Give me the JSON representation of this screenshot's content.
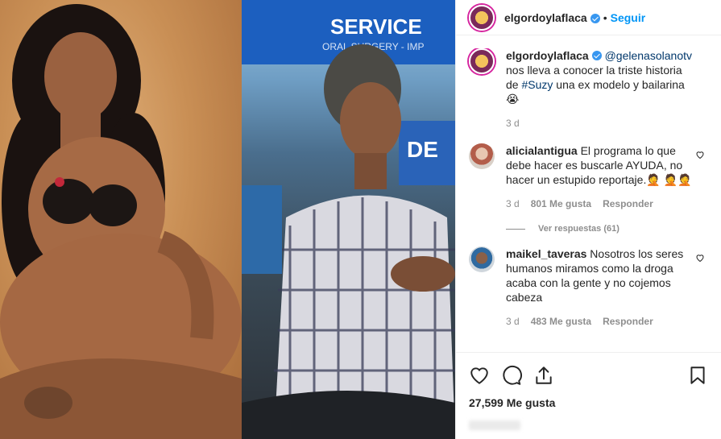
{
  "post": {
    "username": "elgordoylaflaca",
    "follow_label": "Seguir",
    "dot": "•"
  },
  "caption": {
    "username": "elgordoylaflaca",
    "mention": "@gelenasolanotv",
    "text1": " nos lleva a conocer la triste historia de ",
    "hashtag": "#Suzy",
    "text2": " una ex modelo y bailarina 😭",
    "time": "3 d"
  },
  "comments": [
    {
      "username": "alicialantigua",
      "text": " El programa lo que debe hacer es buscarle AYUDA, no hacer un estupido reportaje.🤦 🤦🤦",
      "time": "3 d",
      "likes": "801 Me gusta",
      "reply": "Responder",
      "view_replies": "Ver respuestas (61)"
    },
    {
      "username": "maikel_taveras",
      "text": " Nosotros los seres humanos miramos como la droga acaba con la gente y no cojemos cabeza",
      "time": "3 d",
      "likes": "483 Me gusta",
      "reply": "Responder"
    }
  ],
  "actions": {
    "likes_count": "27,599 Me gusta"
  },
  "media": {
    "sign_line1": "SERVICE",
    "sign_line2": "ORAL SURGERY - IMP",
    "sign_right": "DE"
  },
  "colors": {
    "accent": "#0095f6",
    "verified": "#3897f0",
    "muted": "#8e8e8e"
  }
}
